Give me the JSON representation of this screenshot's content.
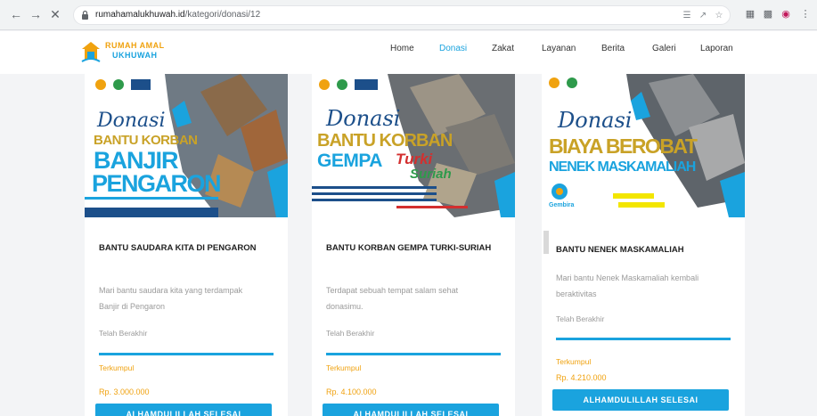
{
  "browser": {
    "url_host": "rumahamalukhuwah.id",
    "url_path": "/kategori/donasi/12"
  },
  "site": {
    "logo_line1": "RUMAH AMAL",
    "logo_line2": "UKHUWAH",
    "nav": [
      {
        "label": "Home",
        "active": false
      },
      {
        "label": "Donasi",
        "active": true
      },
      {
        "label": "Zakat",
        "active": false
      },
      {
        "label": "Layanan",
        "active": false
      },
      {
        "label": "Berita",
        "active": false
      },
      {
        "label": "Galeri",
        "active": false
      },
      {
        "label": "Laporan",
        "active": false
      }
    ]
  },
  "campaigns": [
    {
      "banner_script": "Donasi",
      "banner_line1": "BANTU KORBAN",
      "banner_line2": "BANJIR",
      "banner_line3": "PENGARON",
      "title": "BANTU SAUDARA KITA DI PENGARON",
      "description": "Mari bantu saudara kita yang terdampak Banjir di Pengaron",
      "status": "Telah Berakhir",
      "progress": 1.0,
      "collected_label": "Terkumpul",
      "collected_amount": "Rp. 3.000.000",
      "button_label": "ALHAMDULILLAH SELESAI"
    },
    {
      "banner_script": "Donasi",
      "banner_line1": "BANTU KORBAN",
      "banner_line2": "GEMPA",
      "banner_line3": "Turki",
      "banner_line4": "Suriah",
      "title": "BANTU KORBAN GEMPA TURKI-SURIAH",
      "description": "Terdapat sebuah tempat salam sehat donasimu.",
      "status": "Telah Berakhir",
      "progress": 1.0,
      "collected_label": "Terkumpul",
      "collected_amount": "Rp. 4.100.000",
      "button_label": "ALHAMDULILLAH SELESAI"
    },
    {
      "banner_script": "Donasi",
      "banner_line1": "BIAYA BEROBAT",
      "banner_line2": "NENEK MASKAMALIAH",
      "banner_org": "Gembira",
      "title": "BANTU NENEK MASKAMALIAH",
      "description": "Mari bantu Nenek Maskamaliah kembali beraktivitas",
      "status": "Telah Berakhir",
      "progress": 1.0,
      "collected_label": "Terkumpul",
      "collected_amount": "Rp. 4.210.000",
      "button_label": "ALHAMDULILLAH SELESAI"
    }
  ],
  "colors": {
    "primary": "#1aa3de",
    "accent": "#f0a20f",
    "gold": "#c9a227",
    "navy": "#1c4f8a"
  }
}
